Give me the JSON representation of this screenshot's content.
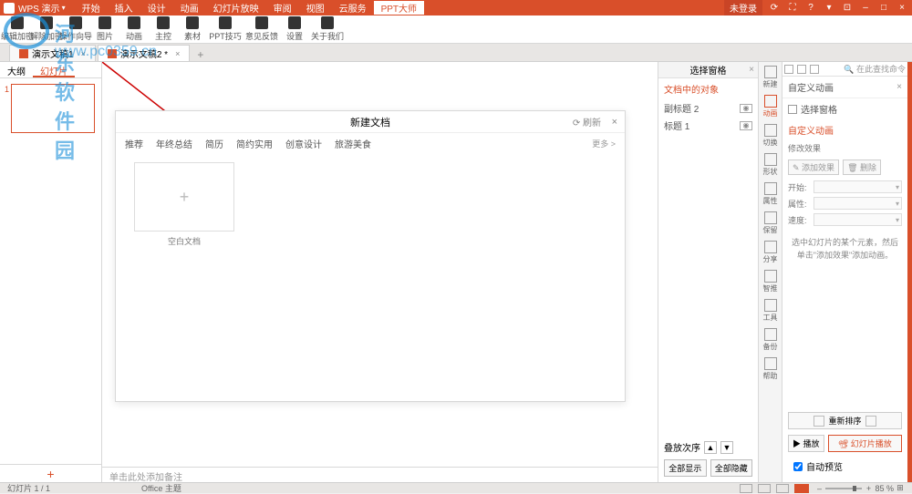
{
  "titlebar": {
    "app": "WPS 演示",
    "menus": [
      "开始",
      "插入",
      "设计",
      "动画",
      "幻灯片放映",
      "审阅",
      "视图",
      "云服务",
      "PPT大师"
    ],
    "active_menu": 8,
    "login": "未登录",
    "icons": [
      "⟳",
      "⛶",
      "?",
      "▾",
      "⊡",
      "–",
      "□",
      "×"
    ]
  },
  "ribbon": [
    {
      "label": "编辑加密"
    },
    {
      "label": "解除加密"
    },
    {
      "label": "操作向导"
    },
    {
      "label": "图片"
    },
    {
      "label": "动画"
    },
    {
      "label": "主控"
    },
    {
      "label": "素材"
    },
    {
      "label": "PPT技巧"
    },
    {
      "label": "意见反馈"
    },
    {
      "label": "设置"
    },
    {
      "label": "关于我们"
    }
  ],
  "watermark": {
    "text": "河东软件园",
    "url": "www.pc0359.cn"
  },
  "doctabs": [
    {
      "label": "演示文稿1"
    },
    {
      "label": "演示文稿2 *",
      "active": true
    }
  ],
  "lefttabs": {
    "outline": "大纲",
    "slides": "幻灯片"
  },
  "thumb_num": "1",
  "dialog": {
    "title": "新建文档",
    "refresh": "⟳ 刷新",
    "cats": [
      "推荐",
      "年终总结",
      "简历",
      "简约实用",
      "创意设计",
      "旅游美食"
    ],
    "more": "更多 >",
    "blank": "空白文档"
  },
  "notes": "单击此处添加备注",
  "selpane": {
    "title": "选择窗格",
    "section": "文档中的对象",
    "objs": [
      "副标题 2",
      "标题 1"
    ],
    "order": "叠放次序",
    "show_all": "全部显示",
    "hide_all": "全部隐藏"
  },
  "iconstrip": [
    {
      "label": "新建"
    },
    {
      "label": "动画",
      "active": true
    },
    {
      "label": "切换"
    },
    {
      "label": "形状"
    },
    {
      "label": "属性"
    },
    {
      "label": "保留"
    },
    {
      "label": "分享"
    },
    {
      "label": "智推"
    },
    {
      "label": "工具"
    },
    {
      "label": "备份"
    },
    {
      "label": "帮助"
    }
  ],
  "animpane": {
    "search": "在此查找命令",
    "title": "自定义动画",
    "select_link": "选择窗格",
    "custom": "自定义动画",
    "modify": "修改效果",
    "add_effect": "添加效果",
    "delete": "删除",
    "start": "开始:",
    "property": "属性:",
    "speed": "速度:",
    "hint": "选中幻灯片的某个元素，然后单击\"添加效果\"添加动画。",
    "reorder": "重新排序",
    "play": "播放",
    "slideshow": "幻灯片播放",
    "auto": "自动预览"
  },
  "statusbar": {
    "slide": "幻灯片 1 / 1",
    "theme": "Office 主题",
    "zoom": "85 %"
  }
}
